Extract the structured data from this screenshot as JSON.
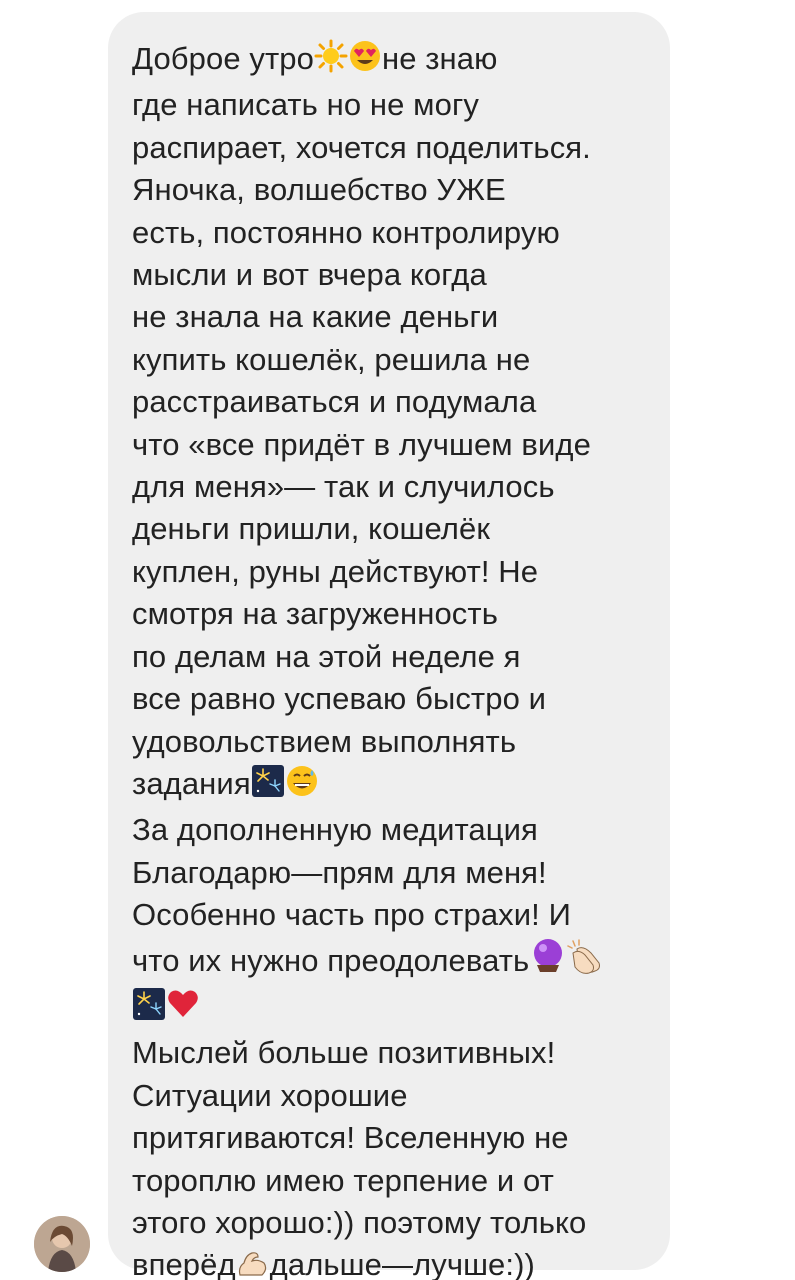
{
  "message": {
    "lines": [
      {
        "text": "Доброе утро",
        "emojis": [
          "sun-icon",
          "heart-eyes-icon"
        ],
        "tail": "не знаю"
      },
      {
        "text": "где написать но не могу"
      },
      {
        "text": "распирает, хочется поделиться."
      },
      {
        "text": "Яночка, волшебство УЖЕ"
      },
      {
        "text": "есть, постоянно контролирую"
      },
      {
        "text": "мысли и вот вчера когда"
      },
      {
        "text": "не знала на какие деньги"
      },
      {
        "text": "купить кошелёк, решила не"
      },
      {
        "text": "расстраиваться и подумала"
      },
      {
        "text": "что «все придёт в лучшем виде"
      },
      {
        "text": "для меня»— так и случилось"
      },
      {
        "text": "деньги пришли, кошелёк"
      },
      {
        "text": "куплен, руны действуют! Не"
      },
      {
        "text": "смотря на загруженность"
      },
      {
        "text": "по делам на этой неделе я"
      },
      {
        "text": "все равно успеваю быстро и"
      },
      {
        "text": "удовольствием выполнять"
      },
      {
        "text": "задания",
        "emojis": [
          "fireworks-icon",
          "sweat-smile-icon"
        ]
      },
      {
        "text": "За дополненную медитация"
      },
      {
        "text": "Благодарю—прям для меня!"
      },
      {
        "text": "Особенно часть про страхи! И"
      },
      {
        "text": "что их нужно преодолевать",
        "emojis": [
          "crystal-ball-icon",
          "clapping-hands-icon"
        ]
      },
      {
        "text": "",
        "emojis": [
          "fireworks-icon",
          "red-heart-icon"
        ]
      },
      {
        "text": "Мыслей больше позитивных!"
      },
      {
        "text": "Ситуации хорошие"
      },
      {
        "text": "притягиваются! Вселенную не"
      },
      {
        "text": "тороплю имею терпение и от"
      },
      {
        "text": "этого хорошо:)) поэтому только"
      },
      {
        "text": "вперёд",
        "emojis": [
          "flexed-biceps-icon"
        ],
        "tail": "дальше—лучше:))"
      }
    ]
  },
  "sender": {
    "avatar_icon": "avatar-photo"
  },
  "colors": {
    "bubble": "#efefef",
    "text": "#222222"
  }
}
